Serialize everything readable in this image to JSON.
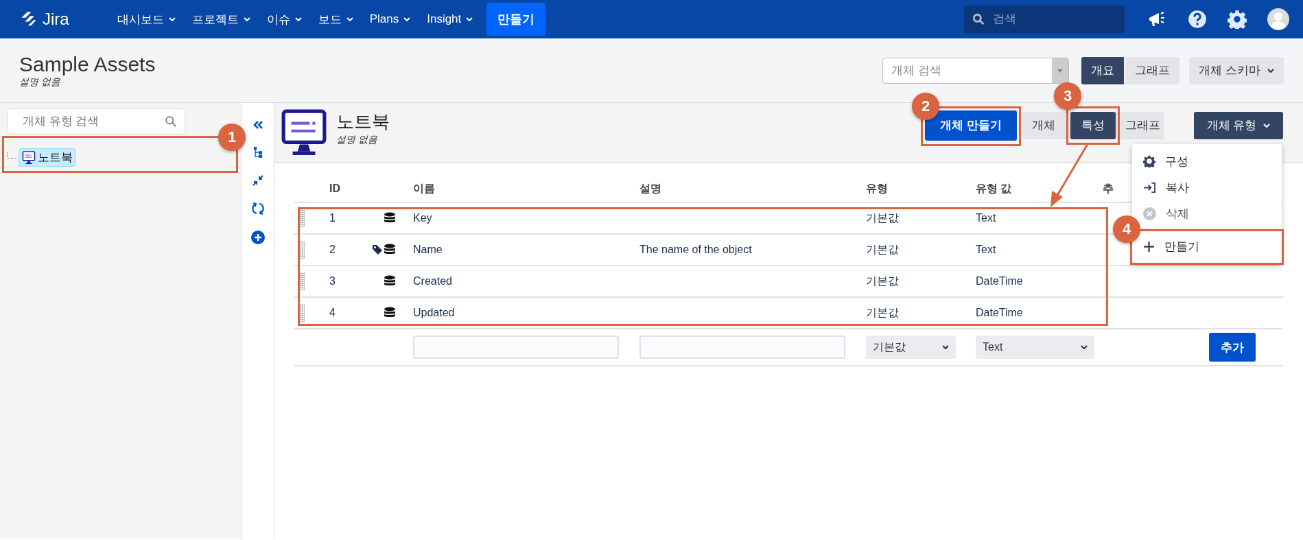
{
  "top_nav": {
    "logo": "Jira",
    "items": [
      {
        "label": "대시보드"
      },
      {
        "label": "프로젝트"
      },
      {
        "label": "이슈"
      },
      {
        "label": "보드"
      },
      {
        "label": "Plans"
      },
      {
        "label": "Insight"
      }
    ],
    "create_button": "만들기",
    "search": {
      "placeholder": "검색"
    }
  },
  "header": {
    "title": "Sample Assets",
    "description": "설명 없음",
    "object_search": {
      "placeholder": "개체 검색"
    },
    "view_tabs": [
      {
        "label": "개요",
        "selected": true
      },
      {
        "label": "그래프",
        "selected": false
      }
    ],
    "schema_menu": "개체 스키마"
  },
  "sidebar": {
    "search": {
      "placeholder": "개체 유형 검색"
    },
    "tree": [
      {
        "label": "노트북",
        "selected": true
      }
    ]
  },
  "object_type": {
    "title": "노트북",
    "description": "설명 없음",
    "create_button": "개체 만들기",
    "tabs": [
      {
        "label": "개체",
        "selected": false
      },
      {
        "label": "특성",
        "selected": true
      },
      {
        "label": "그래프",
        "selected": false
      }
    ],
    "type_menu": "개체 유형"
  },
  "table": {
    "columns": [
      "ID",
      "이름",
      "설명",
      "유형",
      "유형 값",
      "추"
    ],
    "rows": [
      {
        "id": "1",
        "is_label": false,
        "name": "Key",
        "description": "",
        "type": "기본값",
        "type_value": "Text"
      },
      {
        "id": "2",
        "is_label": true,
        "name": "Name",
        "description": "The name of the object",
        "type": "기본값",
        "type_value": "Text"
      },
      {
        "id": "3",
        "is_label": false,
        "name": "Created",
        "description": "",
        "type": "기본값",
        "type_value": "DateTime"
      },
      {
        "id": "4",
        "is_label": false,
        "name": "Updated",
        "description": "",
        "type": "기본값",
        "type_value": "DateTime"
      }
    ],
    "new_row": {
      "type_select": "기본값",
      "value_select": "Text",
      "add_button": "추가"
    }
  },
  "dropdown": {
    "items": [
      {
        "kind": "settings",
        "label": "구성"
      },
      {
        "kind": "copy",
        "label": "복사"
      },
      {
        "kind": "delete",
        "label": "삭제"
      },
      {
        "kind": "create",
        "label": "만들기"
      }
    ]
  },
  "annotations": [
    {
      "number": "1"
    },
    {
      "number": "2"
    },
    {
      "number": "3"
    },
    {
      "number": "4"
    }
  ]
}
